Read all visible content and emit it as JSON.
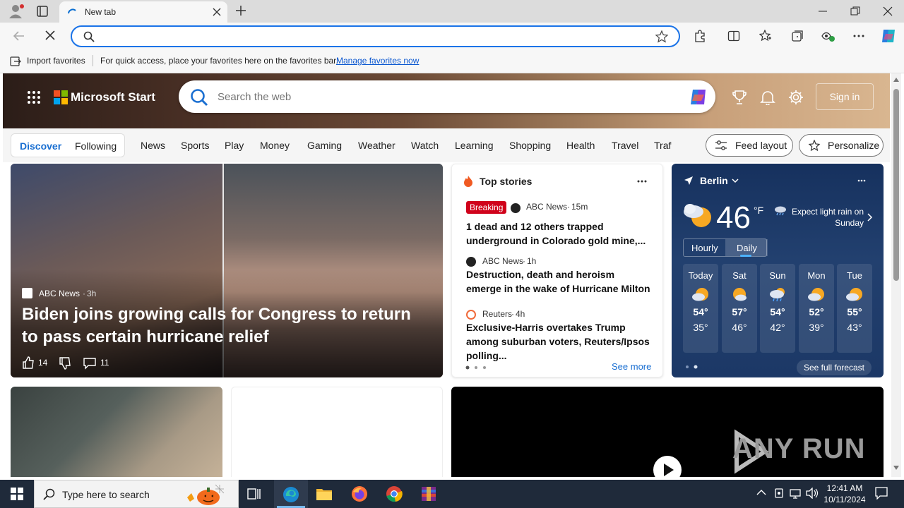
{
  "browser": {
    "tab_title": "New tab",
    "new_tab_symbol": "+",
    "window_controls": [
      "minimize-icon",
      "restore-icon",
      "close-icon"
    ],
    "omnibox_value": "",
    "favorites_bar": {
      "import_label": "Import favorites",
      "message": "For quick access, place your favorites here on the favorites bar.",
      "manage_link": "Manage favorites now"
    }
  },
  "msn": {
    "brand": "Microsoft Start",
    "search_placeholder": "Search the web",
    "sign_in": "Sign in",
    "nav": {
      "discover": "Discover",
      "following": "Following",
      "items": [
        "News",
        "Sports",
        "Play",
        "Money",
        "Gaming",
        "Weather",
        "Watch",
        "Learning",
        "Shopping",
        "Health",
        "Travel",
        "Traf"
      ],
      "feed_layout": "Feed layout",
      "personalize": "Personalize"
    },
    "lead_story": {
      "source": "ABC News",
      "time": "3h",
      "headline": "Biden joins growing calls for Congress to return to pass certain hurricane relief",
      "likes": "14",
      "comments": "11"
    },
    "top_stories": {
      "title": "Top stories",
      "breaking": "Breaking",
      "stories": [
        {
          "source": "ABC News",
          "time": "15m",
          "headline": "1 dead and 12 others trapped underground in Colorado gold mine,..."
        },
        {
          "source": "ABC News",
          "time": "1h",
          "headline": "Destruction, death and heroism emerge in the wake of Hurricane Milton"
        },
        {
          "source": "Reuters",
          "time": "4h",
          "headline": "Exclusive-Harris overtakes Trump among suburban voters, Reuters/Ipsos polling..."
        }
      ],
      "see_more": "See more"
    },
    "weather": {
      "city": "Berlin",
      "temp": "46",
      "unit": "°F",
      "summary": "Expect light rain on Sunday",
      "tabs": [
        "Hourly",
        "Daily"
      ],
      "days": [
        {
          "name": "Today",
          "hi": "54°",
          "lo": "35°"
        },
        {
          "name": "Sat",
          "hi": "57°",
          "lo": "46°"
        },
        {
          "name": "Sun",
          "hi": "54°",
          "lo": "42°"
        },
        {
          "name": "Mon",
          "hi": "52°",
          "lo": "39°"
        },
        {
          "name": "Tue",
          "hi": "55°",
          "lo": "43°"
        }
      ],
      "full_forecast": "See full forecast"
    },
    "watermark": "ANY RUN"
  },
  "taskbar": {
    "search_placeholder": "Type here to search",
    "time": "12:41 AM",
    "date": "10/11/2024"
  }
}
